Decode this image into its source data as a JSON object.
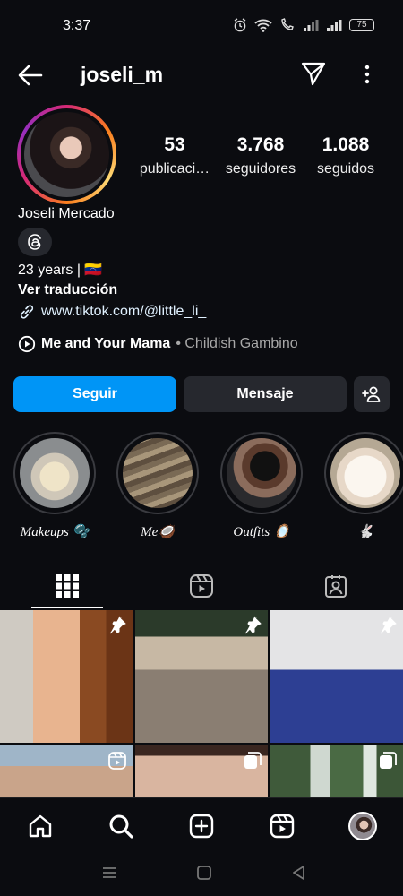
{
  "status_bar": {
    "time": "3:37",
    "battery": "75"
  },
  "header": {
    "username": "joseli_m"
  },
  "stats": [
    {
      "value": "53",
      "label": "publicaci…"
    },
    {
      "value": "3.768",
      "label": "seguidores"
    },
    {
      "value": "1.088",
      "label": "seguidos"
    }
  ],
  "profile": {
    "name": "Joseli Mercado",
    "bio_line": "23 years |",
    "flag": "🇻🇪",
    "translate": "Ver traducción",
    "link": "www.tiktok.com/@little_li_",
    "music_title": "Me and Your Mama",
    "music_artist": "• Childish Gambino"
  },
  "buttons": {
    "follow": "Seguir",
    "message": "Mensaje"
  },
  "highlights": [
    {
      "label": "Makeups 🫧"
    },
    {
      "label": "Me🥥"
    },
    {
      "label": "Outfits 🪞"
    },
    {
      "label": "🐇"
    }
  ],
  "tabs": [
    "posts-grid",
    "reels",
    "tagged"
  ],
  "colors": {
    "accent": "#0095f6",
    "background": "#0b0c10",
    "button_dark": "#26282e"
  }
}
